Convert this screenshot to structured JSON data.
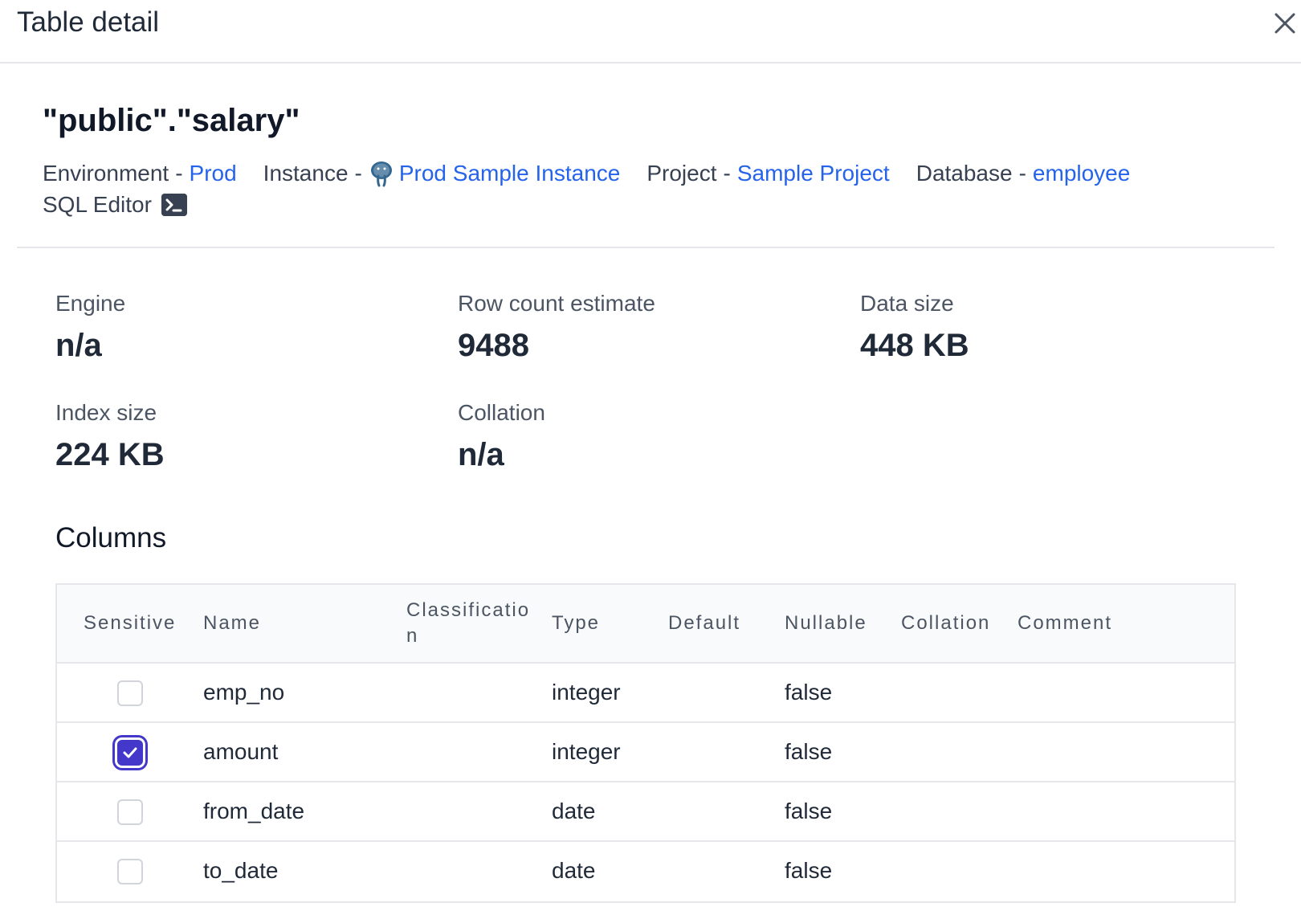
{
  "header": {
    "title": "Table detail"
  },
  "table_name": "\"public\".\"salary\"",
  "meta": {
    "environment": {
      "label": "Environment",
      "value": "Prod"
    },
    "instance": {
      "label": "Instance",
      "value": "Prod Sample Instance",
      "icon": "postgres-elephant-icon"
    },
    "project": {
      "label": "Project",
      "value": "Sample Project"
    },
    "database": {
      "label": "Database",
      "value": "employee"
    },
    "separator": "-",
    "sql_editor": {
      "label": "SQL Editor",
      "icon": "terminal-icon"
    }
  },
  "stats": {
    "engine": {
      "label": "Engine",
      "value": "n/a"
    },
    "row_count": {
      "label": "Row count estimate",
      "value": "9488"
    },
    "data_size": {
      "label": "Data size",
      "value": "448 KB"
    },
    "index_size": {
      "label": "Index size",
      "value": "224 KB"
    },
    "collation": {
      "label": "Collation",
      "value": "n/a"
    }
  },
  "columns_section": {
    "title": "Columns",
    "headers": {
      "sensitive": "Sensitive",
      "name": "Name",
      "classification": "Classification",
      "type": "Type",
      "default": "Default",
      "nullable": "Nullable",
      "collation": "Collation",
      "comment": "Comment"
    },
    "rows": [
      {
        "sensitive": false,
        "name": "emp_no",
        "type": "integer",
        "nullable": "false"
      },
      {
        "sensitive": true,
        "name": "amount",
        "type": "integer",
        "nullable": "false"
      },
      {
        "sensitive": false,
        "name": "from_date",
        "type": "date",
        "nullable": "false"
      },
      {
        "sensitive": false,
        "name": "to_date",
        "type": "date",
        "nullable": "false"
      }
    ]
  },
  "colors": {
    "link": "#2563eb",
    "checkbox_checked": "#4338ca"
  }
}
